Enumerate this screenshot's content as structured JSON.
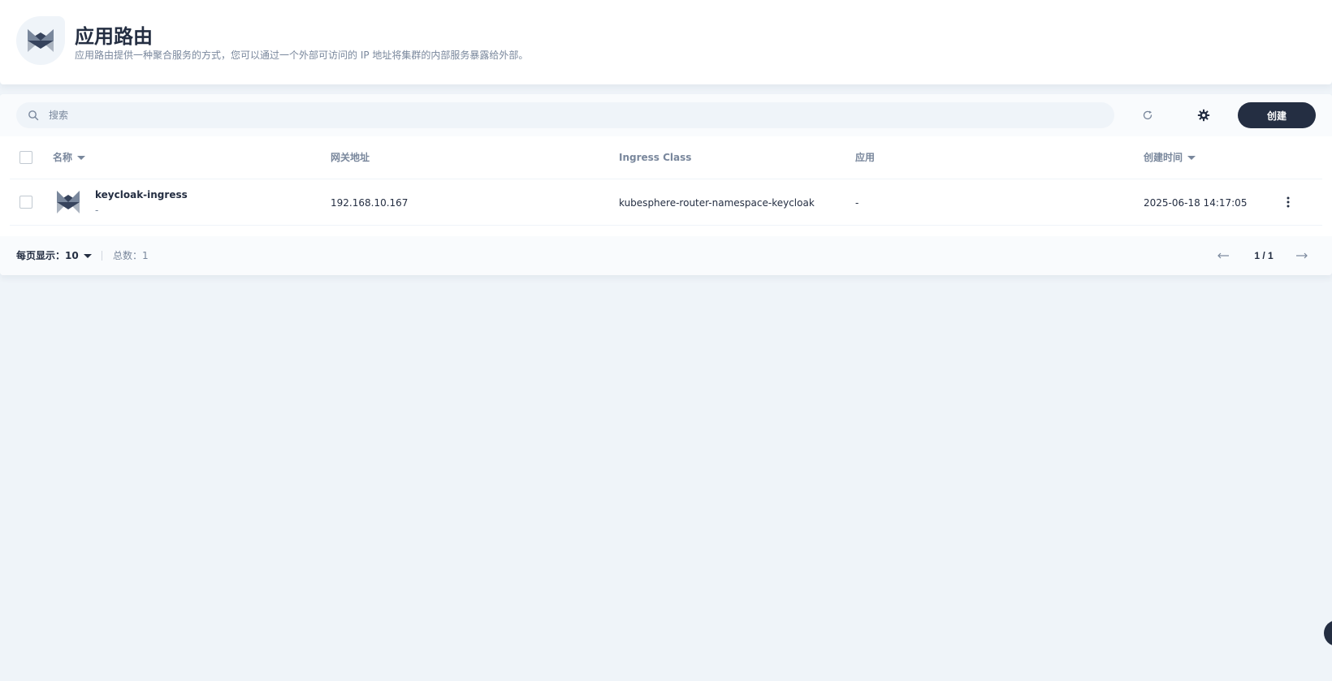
{
  "header": {
    "title": "应用路由",
    "description": "应用路由提供一种聚合服务的方式，您可以通过一个外部可访问的 IP 地址将集群的内部服务暴露给外部。"
  },
  "toolbar": {
    "search_placeholder": "搜索",
    "search_value": "",
    "create_label": "创建"
  },
  "table": {
    "columns": {
      "name": "名称",
      "gateway": "网关地址",
      "ingress_class": "Ingress Class",
      "app": "应用",
      "created": "创建时间"
    },
    "rows": [
      {
        "name": "keycloak-ingress",
        "subtitle": "-",
        "gateway": "192.168.10.167",
        "ingress_class": "kubesphere-router-namespace-keycloak",
        "app": "-",
        "created": "2025-06-18 14:17:05"
      }
    ]
  },
  "footer": {
    "per_page_label": "每页显示：",
    "per_page_value": "10",
    "total_label": "总数：1",
    "page_indicator": "1 / 1"
  },
  "colors": {
    "background": "#eff4f9",
    "primary_dark": "#242e42",
    "muted_text": "#79879c"
  },
  "icons": {
    "header": "ingress-icon",
    "search": "search-icon",
    "refresh": "refresh-icon",
    "settings": "gear-icon",
    "row": "ingress-icon",
    "more": "more-vertical-icon",
    "prev": "arrow-left-icon",
    "next": "arrow-right-icon"
  }
}
